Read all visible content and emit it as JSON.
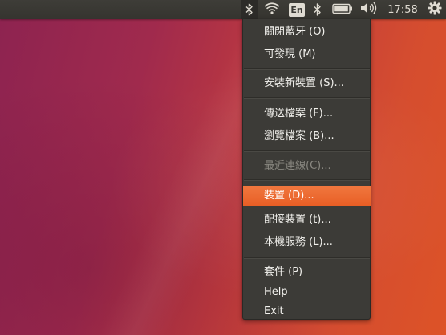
{
  "panel": {
    "indicators": {
      "bluetooth_icon": "bluetooth-icon",
      "wifi_icon": "wifi-icon",
      "language": "En",
      "bluetooth_secondary_icon": "bluetooth-icon",
      "battery_icon": "battery-icon",
      "volume_icon": "volume-icon",
      "clock": "17:58",
      "system_icon": "gear-icon"
    }
  },
  "bluetooth_menu": {
    "items": [
      {
        "label": "關閉藍牙 (O)",
        "state": "normal"
      },
      {
        "label": "可發現 (M)",
        "state": "normal"
      },
      {
        "label": "安裝新裝置 (S)...",
        "state": "normal"
      },
      {
        "label": "傳送檔案 (F)...",
        "state": "normal"
      },
      {
        "label": "瀏覽檔案 (B)...",
        "state": "normal"
      },
      {
        "label": "最近連線(C)...",
        "state": "disabled"
      },
      {
        "label": "裝置 (D)...",
        "state": "highlighted"
      },
      {
        "label": "配接裝置 (t)...",
        "state": "normal"
      },
      {
        "label": "本機服務 (L)...",
        "state": "normal"
      },
      {
        "label": "套件 (P)",
        "state": "normal"
      },
      {
        "label": "Help",
        "state": "normal"
      },
      {
        "label": "Exit",
        "state": "normal"
      }
    ]
  },
  "colors": {
    "panel": "#3c3b37",
    "menu_background": "#3c3b37",
    "highlight": "#e8632a",
    "menu_text": "#f2f1ed",
    "disabled_text": "#8a8881"
  }
}
